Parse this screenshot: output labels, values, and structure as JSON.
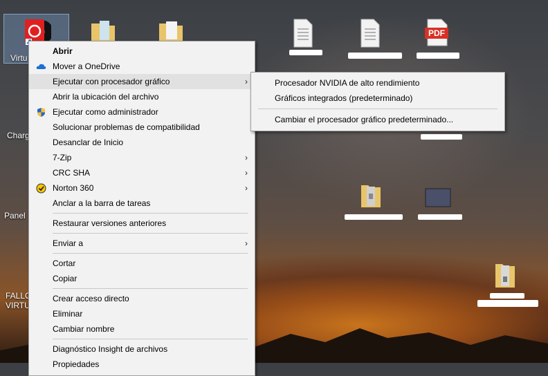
{
  "desktop": {
    "icons": [
      {
        "label": "Virtu"
      },
      {
        "label": "Charg"
      },
      {
        "label": "Panel"
      },
      {
        "label": "FALLO\nVIRTU"
      }
    ],
    "pdf_badge": "PDF"
  },
  "context_menu": {
    "items": [
      {
        "label": "Abrir",
        "bold": true
      },
      {
        "label": "Mover a OneDrive",
        "icon": "onedrive-cloud-icon"
      },
      {
        "label": "Ejecutar con procesador gráfico",
        "submenu": true,
        "highlighted": true
      },
      {
        "label": "Abrir la ubicación del archivo"
      },
      {
        "label": "Ejecutar como administrador",
        "icon": "uac-shield-icon"
      },
      {
        "label": "Solucionar problemas de compatibilidad"
      },
      {
        "label": "Desanclar de Inicio"
      },
      {
        "label": "7-Zip",
        "submenu": true
      },
      {
        "label": "CRC SHA",
        "submenu": true
      },
      {
        "label": "Norton 360",
        "submenu": true,
        "icon": "norton-icon"
      },
      {
        "label": "Anclar a la barra de tareas"
      },
      {
        "label": "Restaurar versiones anteriores"
      },
      {
        "label": "Enviar a",
        "submenu": true
      },
      {
        "label": "Cortar"
      },
      {
        "label": "Copiar"
      },
      {
        "label": "Crear acceso directo"
      },
      {
        "label": "Eliminar"
      },
      {
        "label": "Cambiar nombre"
      },
      {
        "label": "Diagnóstico Insight de archivos"
      },
      {
        "label": "Propiedades"
      }
    ]
  },
  "gpu_submenu": {
    "items": [
      {
        "label": "Procesador NVIDIA de alto rendimiento"
      },
      {
        "label": "Gráficos integrados (predeterminado)"
      },
      {
        "label": "Cambiar el procesador gráfico predeterminado..."
      }
    ]
  },
  "colors": {
    "menu_bg": "#f2f2f2",
    "highlight": "#e1e1e1",
    "pdf_red": "#d93025"
  }
}
